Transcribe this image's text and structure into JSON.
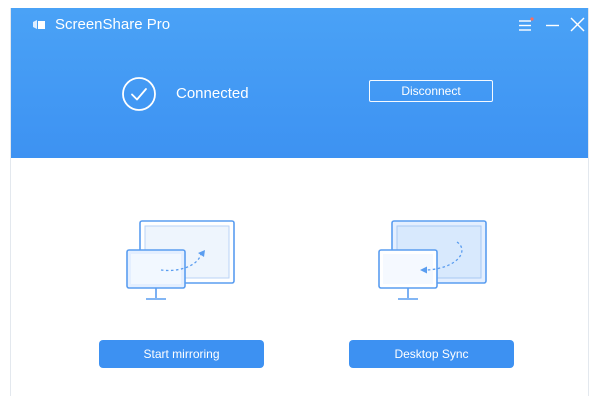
{
  "app": {
    "title": "ScreenShare Pro"
  },
  "window_controls": {
    "menu_icon": "hamburger-menu-icon",
    "minimize_icon": "minimize-icon",
    "close_icon": "close-icon"
  },
  "status": {
    "text": "Connected",
    "icon": "check-circle-icon"
  },
  "header_actions": {
    "disconnect_label": "Disconnect"
  },
  "actions": {
    "start_mirroring": {
      "label": "Start mirroring",
      "icon": "screen-mirror-illustration"
    },
    "desktop_sync": {
      "label": "Desktop Sync",
      "icon": "desktop-sync-illustration"
    }
  },
  "colors": {
    "header_blue": "#3d92f2",
    "button_blue": "#3d91f2",
    "illustration_blue": "#5a9df0"
  }
}
